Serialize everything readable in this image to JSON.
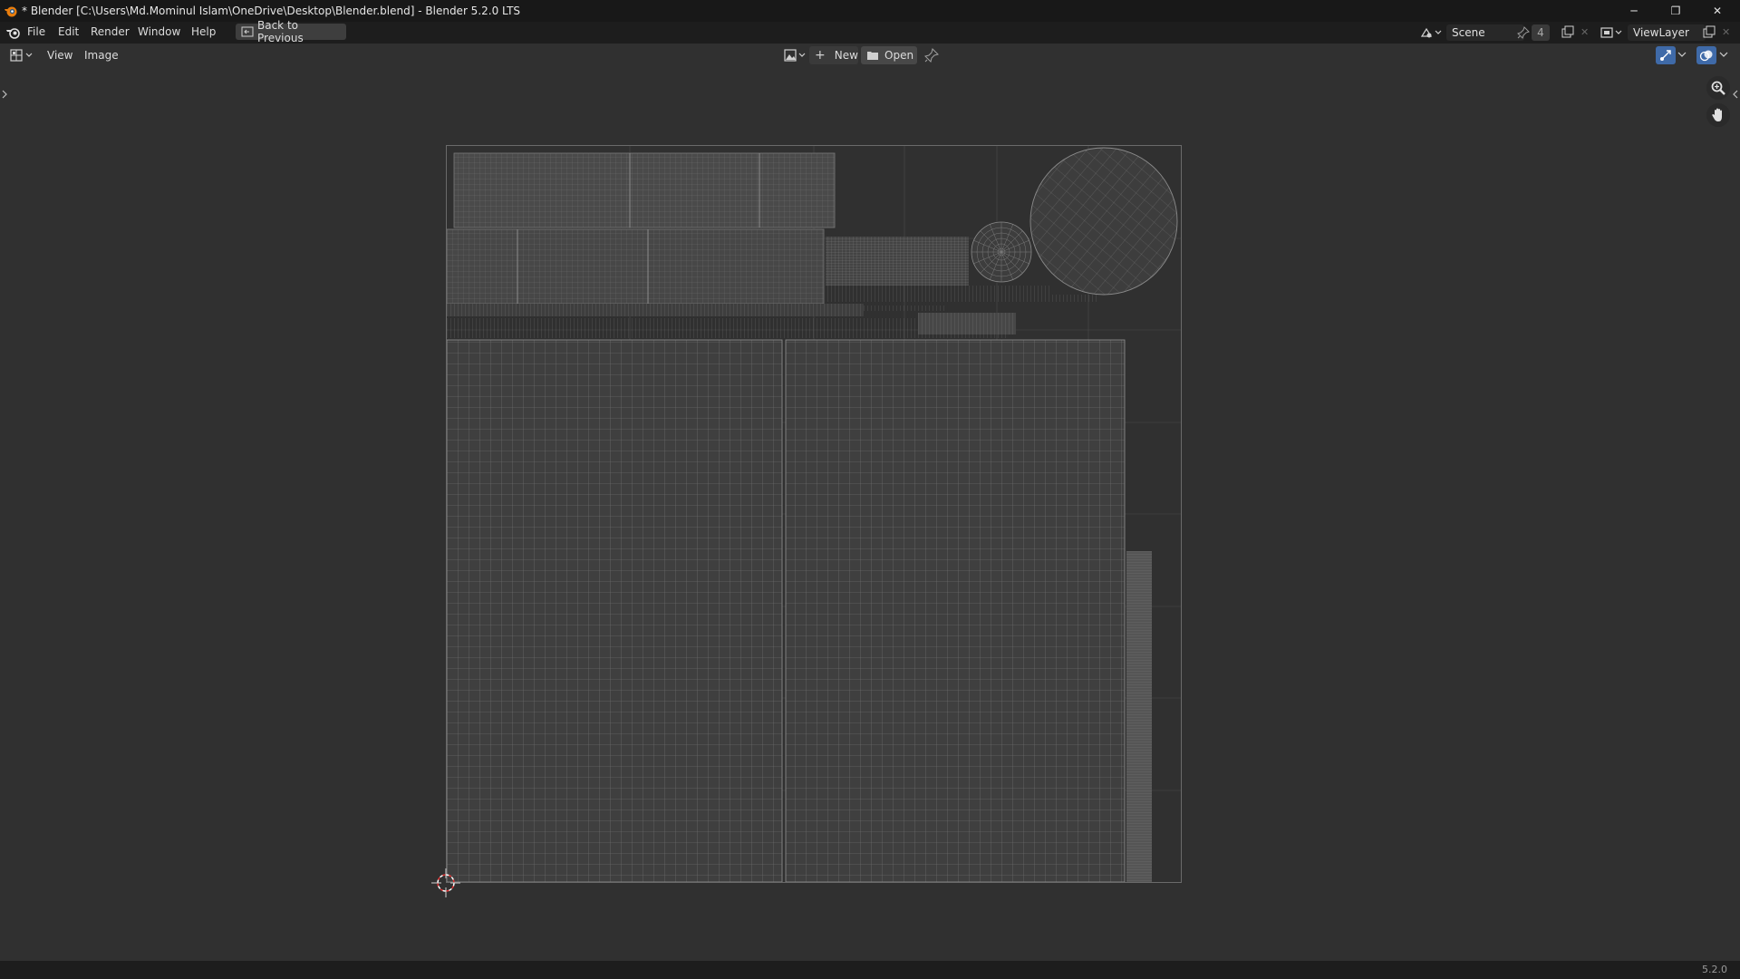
{
  "window": {
    "title": "* Blender [C:\\Users\\Md.Mominul Islam\\OneDrive\\Desktop\\Blender.blend] - Blender 5.2.0 LTS",
    "minimize_glyph": "─",
    "maximize_glyph": "❐",
    "close_glyph": "✕"
  },
  "menu": {
    "file": "File",
    "edit": "Edit",
    "render": "Render",
    "window": "Window",
    "help": "Help",
    "back_to_previous": "Back to Previous"
  },
  "scene": {
    "name": "Scene",
    "users": "4",
    "view_layer": "ViewLayer"
  },
  "editor_header": {
    "view": "View",
    "image": "Image",
    "new": "New",
    "open": "Open"
  },
  "status": {
    "version": "5.2.0"
  },
  "icons": {
    "app": "blender-logo-icon",
    "editor_type": "uv-editor-icon",
    "new": "plus-icon",
    "open": "folder-icon",
    "pin": "pin-icon",
    "zoom": "zoom-icon",
    "pan": "hand-icon",
    "cursor": "2d-cursor-icon"
  },
  "colors": {
    "background": "#303030",
    "titlebar": "#181818",
    "topbar": "#1d1d1d",
    "uv_wire": "#8a8a8a",
    "uv_fill": "#484848"
  }
}
